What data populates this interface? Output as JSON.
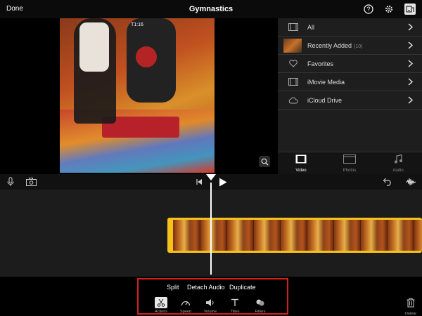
{
  "topbar": {
    "done_label": "Done",
    "title": "Gymnastics"
  },
  "preview": {
    "time_label": "T1:16"
  },
  "browser": {
    "items": [
      {
        "label": "All",
        "icon": "film-icon",
        "count": ""
      },
      {
        "label": "Recently Added",
        "icon": "thumbnail",
        "count": "(10)"
      },
      {
        "label": "Favorites",
        "icon": "heart-icon",
        "count": ""
      },
      {
        "label": "iMovie Media",
        "icon": "film-icon",
        "count": ""
      },
      {
        "label": "iCloud Drive",
        "icon": "cloud-icon",
        "count": ""
      }
    ],
    "tabs": [
      {
        "label": "Video",
        "icon": "film-icon",
        "active": true
      },
      {
        "label": "Photos",
        "icon": "photos-icon",
        "active": false
      },
      {
        "label": "Audio",
        "icon": "music-icon",
        "active": false
      }
    ]
  },
  "actions": {
    "split": "Split",
    "detach_audio": "Detach Audio",
    "duplicate": "Duplicate"
  },
  "tools": [
    {
      "label": "Actions",
      "icon": "scissors-icon",
      "selected": true
    },
    {
      "label": "Speed",
      "icon": "speedometer-icon",
      "selected": false
    },
    {
      "label": "Volume",
      "icon": "speaker-icon",
      "selected": false
    },
    {
      "label": "Titles",
      "icon": "text-icon",
      "selected": false
    },
    {
      "label": "Filters",
      "icon": "filters-icon",
      "selected": false
    }
  ],
  "delete_label": "Delete",
  "colors": {
    "clip_border": "#f7c21c",
    "highlight": "#d62020",
    "background": "#000000"
  }
}
